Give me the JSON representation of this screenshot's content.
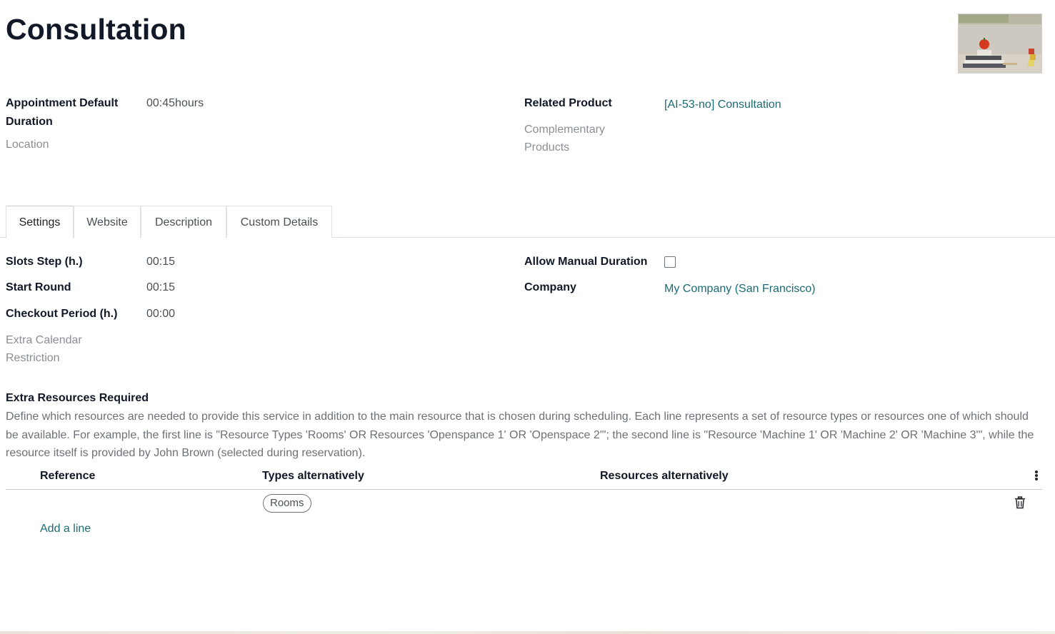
{
  "record": {
    "title": "Consultation"
  },
  "header_fields": {
    "default_duration_label_line1": "Appointment Default",
    "default_duration_label_line2": "Duration",
    "default_duration_value": "00:45hours",
    "location_label": "Location",
    "related_product_label": "Related Product",
    "related_product_value": "[AI-53-no] Consultation",
    "complementary_label_line1": "Complementary",
    "complementary_label_line2": "Products"
  },
  "tabs": [
    {
      "label": "Settings",
      "active": true
    },
    {
      "label": "Website",
      "active": false
    },
    {
      "label": "Description",
      "active": false
    },
    {
      "label": "Custom Details",
      "active": false
    }
  ],
  "settings": {
    "slots_step_label": "Slots Step (h.)",
    "slots_step_value": "00:15",
    "start_round_label": "Start Round",
    "start_round_value": "00:15",
    "checkout_label": "Checkout Period (h.)",
    "checkout_value": "00:00",
    "extra_calendar_line1": "Extra Calendar",
    "extra_calendar_line2": "Restriction",
    "allow_manual_label": "Allow Manual Duration",
    "allow_manual_checked": false,
    "company_label": "Company",
    "company_value": "My Company (San Francisco)"
  },
  "resources": {
    "title": "Extra Resources Required",
    "help": "Define which resources are needed to provide this service in addition to the main resource that is chosen during scheduling. Each line represents a set of resource types or resources one of which should be available. For example, the first line is \"Resource Types 'Rooms' OR Resources 'Openspance 1' OR 'Openspace 2'\"; the second line is \"Resource 'Machine 1' OR 'Machine 2' OR 'Machine 3'\", while the resource itself is provided by John Brown (selected during reservation).",
    "columns": [
      "Reference",
      "Types alternatively",
      "Resources alternatively"
    ],
    "rows": [
      {
        "reference": "",
        "types": [
          "Rooms"
        ],
        "resources": []
      }
    ],
    "add_line_label": "Add a line"
  },
  "icons": {
    "options": "vertical-dots-icon",
    "delete": "trash-icon"
  },
  "colors": {
    "link": "#1b6b74",
    "muted_label": "#8a8f96"
  }
}
